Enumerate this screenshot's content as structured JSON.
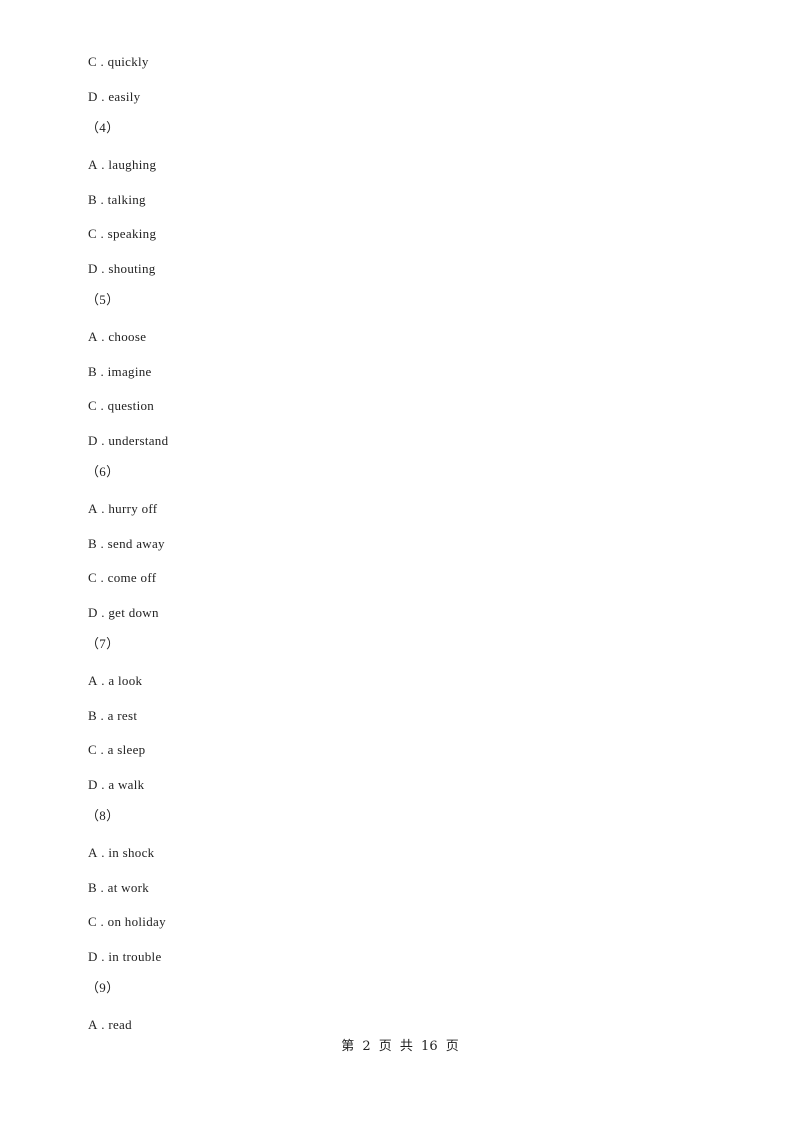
{
  "lines": [
    {
      "type": "option",
      "letter": "C",
      "text": "quickly"
    },
    {
      "type": "option",
      "letter": "D",
      "text": "easily"
    },
    {
      "type": "question",
      "text": "（4）"
    },
    {
      "type": "option",
      "letter": "A",
      "text": "laughing"
    },
    {
      "type": "option",
      "letter": "B",
      "text": "talking"
    },
    {
      "type": "option",
      "letter": "C",
      "text": "speaking"
    },
    {
      "type": "option",
      "letter": "D",
      "text": "shouting"
    },
    {
      "type": "question",
      "text": "（5）"
    },
    {
      "type": "option",
      "letter": "A",
      "text": "choose"
    },
    {
      "type": "option",
      "letter": "B",
      "text": "imagine"
    },
    {
      "type": "option",
      "letter": "C",
      "text": "question"
    },
    {
      "type": "option",
      "letter": "D",
      "text": "understand"
    },
    {
      "type": "question",
      "text": "（6）"
    },
    {
      "type": "option",
      "letter": "A",
      "text": "hurry off"
    },
    {
      "type": "option",
      "letter": "B",
      "text": "send away"
    },
    {
      "type": "option",
      "letter": "C",
      "text": "come off"
    },
    {
      "type": "option",
      "letter": "D",
      "text": "get down"
    },
    {
      "type": "question",
      "text": "（7）"
    },
    {
      "type": "option",
      "letter": "A",
      "text": "a look"
    },
    {
      "type": "option",
      "letter": "B",
      "text": "a rest"
    },
    {
      "type": "option",
      "letter": "C",
      "text": "a sleep"
    },
    {
      "type": "option",
      "letter": "D",
      "text": "a walk"
    },
    {
      "type": "question",
      "text": "（8）"
    },
    {
      "type": "option",
      "letter": "A",
      "text": "in shock"
    },
    {
      "type": "option",
      "letter": "B",
      "text": "at work"
    },
    {
      "type": "option",
      "letter": "C",
      "text": "on holiday"
    },
    {
      "type": "option",
      "letter": "D",
      "text": "in trouble"
    },
    {
      "type": "question",
      "text": "（9）"
    },
    {
      "type": "option",
      "letter": "A",
      "text": "read"
    }
  ],
  "footer": {
    "text": "第 2 页 共 16 页"
  }
}
